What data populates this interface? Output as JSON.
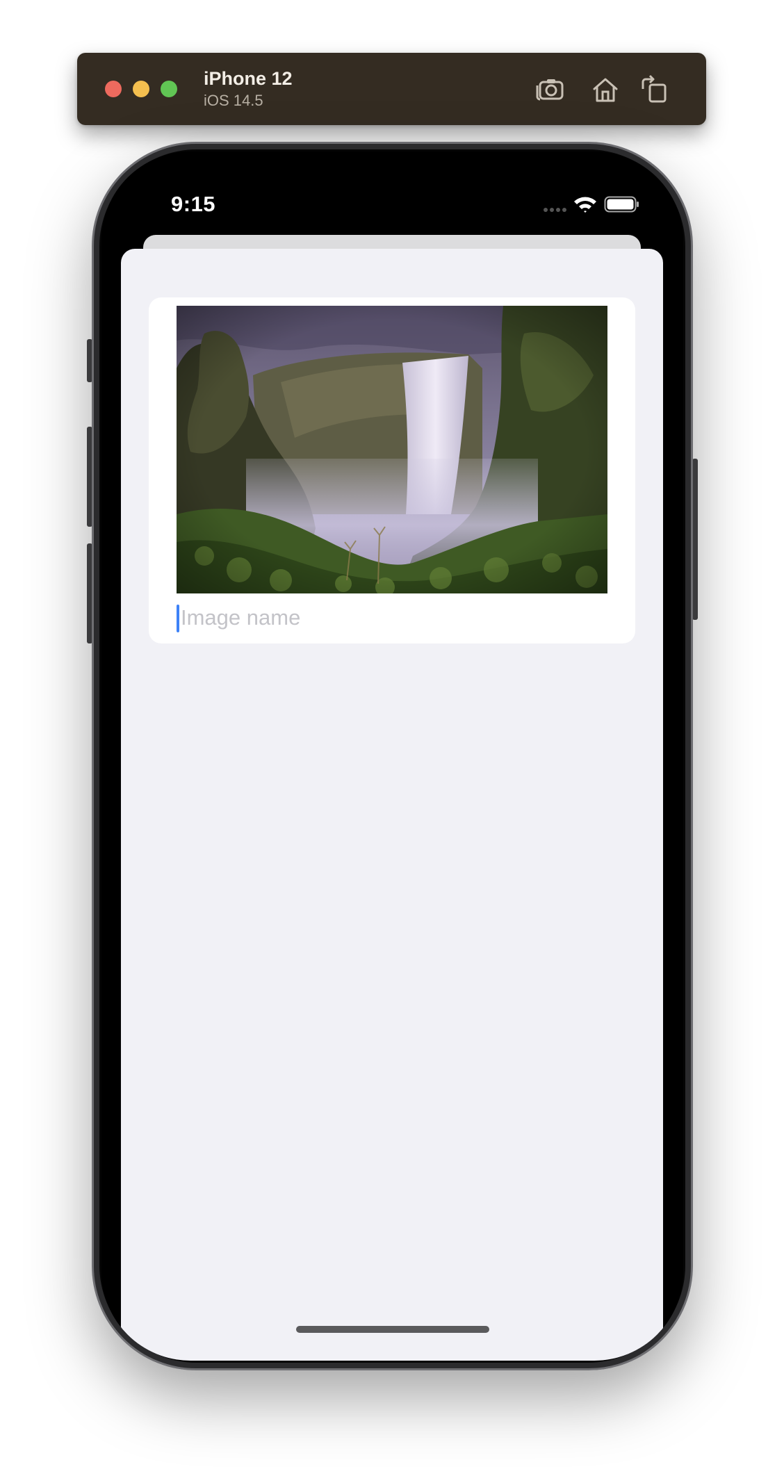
{
  "window": {
    "device_name": "iPhone 12",
    "os_version": "iOS 14.5",
    "buttons": {
      "screenshot_icon": "camera-icon",
      "home_icon": "home-icon",
      "rotate_icon": "rotate-icon"
    },
    "traffic_lights": {
      "close": "#ed6a5e",
      "minimize": "#f4bf4f",
      "zoom": "#61c554"
    }
  },
  "status_bar": {
    "time": "9:15",
    "icons": [
      "cellular-signal-icon",
      "wifi-icon",
      "battery-icon"
    ]
  },
  "card": {
    "image": "waterfall-photo",
    "name_field": {
      "value": "",
      "placeholder": "Image name"
    }
  },
  "colors": {
    "sheet_background": "#f1f1f6",
    "card_background": "#ffffff",
    "caret": "#3e82f7",
    "toolbar": "#342c22"
  }
}
